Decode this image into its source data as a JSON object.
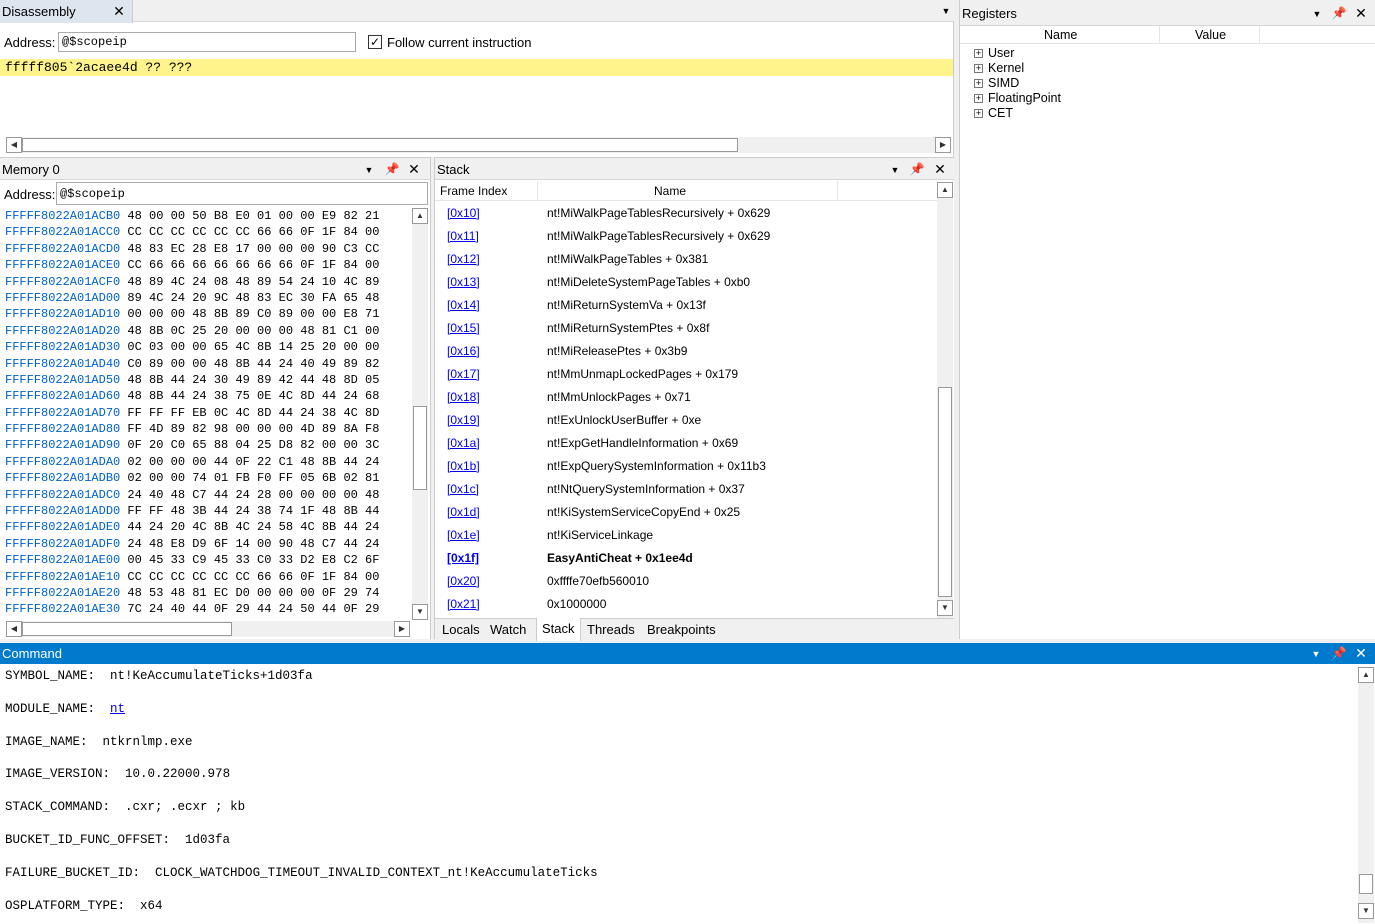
{
  "disassembly": {
    "tab_title": "Disassembly",
    "address_label": "Address:",
    "address_value": "@$scopeip",
    "follow_label": "Follow current instruction",
    "follow_checked": true,
    "current_line": "fffff805`2acaee4d ?? ???"
  },
  "registers": {
    "title": "Registers",
    "col_name": "Name",
    "col_value": "Value",
    "groups": [
      "User",
      "Kernel",
      "SIMD",
      "FloatingPoint",
      "CET"
    ]
  },
  "memory": {
    "title": "Memory 0",
    "address_label": "Address:",
    "address_value": "@$scopeip",
    "rows": [
      {
        "addr": "FFFFF8022A01ACB0",
        "bytes": "48 00 00 50 B8 E0 01 00 00 E9 82 21"
      },
      {
        "addr": "FFFFF8022A01ACC0",
        "bytes": "CC CC CC CC CC CC 66 66 0F 1F 84 00"
      },
      {
        "addr": "FFFFF8022A01ACD0",
        "bytes": "48 83 EC 28 E8 17 00 00 00 90 C3 CC"
      },
      {
        "addr": "FFFFF8022A01ACE0",
        "bytes": "CC 66 66 66 66 66 66 66 0F 1F 84 00"
      },
      {
        "addr": "FFFFF8022A01ACF0",
        "bytes": "48 89 4C 24 08 48 89 54 24 10 4C 89"
      },
      {
        "addr": "FFFFF8022A01AD00",
        "bytes": "89 4C 24 20 9C 48 83 EC 30 FA 65 48"
      },
      {
        "addr": "FFFFF8022A01AD10",
        "bytes": "00 00 00 48 8B 89 C0 89 00 00 E8 71"
      },
      {
        "addr": "FFFFF8022A01AD20",
        "bytes": "48 8B 0C 25 20 00 00 00 48 81 C1 00"
      },
      {
        "addr": "FFFFF8022A01AD30",
        "bytes": "0C 03 00 00 65 4C 8B 14 25 20 00 00"
      },
      {
        "addr": "FFFFF8022A01AD40",
        "bytes": "C0 89 00 00 48 8B 44 24 40 49 89 82"
      },
      {
        "addr": "FFFFF8022A01AD50",
        "bytes": "48 8B 44 24 30 49 89 42 44 48 8D 05"
      },
      {
        "addr": "FFFFF8022A01AD60",
        "bytes": "48 8B 44 24 38 75 0E 4C 8D 44 24 68"
      },
      {
        "addr": "FFFFF8022A01AD70",
        "bytes": "FF FF FF EB 0C 4C 8D 44 24 38 4C 8D"
      },
      {
        "addr": "FFFFF8022A01AD80",
        "bytes": "FF 4D 89 82 98 00 00 00 4D 89 8A F8"
      },
      {
        "addr": "FFFFF8022A01AD90",
        "bytes": "0F 20 C0 65 88 04 25 D8 82 00 00 3C"
      },
      {
        "addr": "FFFFF8022A01ADA0",
        "bytes": "02 00 00 00 44 0F 22 C1 48 8B 44 24"
      },
      {
        "addr": "FFFFF8022A01ADB0",
        "bytes": "02 00 00 74 01 FB F0 FF 05 6B 02 81"
      },
      {
        "addr": "FFFFF8022A01ADC0",
        "bytes": "24 40 48 C7 44 24 28 00 00 00 00 48"
      },
      {
        "addr": "FFFFF8022A01ADD0",
        "bytes": "FF FF 48 3B 44 24 38 74 1F 48 8B 44"
      },
      {
        "addr": "FFFFF8022A01ADE0",
        "bytes": "44 24 20 4C 8B 4C 24 58 4C 8B 44 24"
      },
      {
        "addr": "FFFFF8022A01ADF0",
        "bytes": "24 48 E8 D9 6F 14 00 90 48 C7 44 24"
      },
      {
        "addr": "FFFFF8022A01AE00",
        "bytes": "00 45 33 C9 45 33 C0 33 D2 E8 C2 6F"
      },
      {
        "addr": "FFFFF8022A01AE10",
        "bytes": "CC CC CC CC CC CC 66 66 0F 1F 84 00"
      },
      {
        "addr": "FFFFF8022A01AE20",
        "bytes": "48 53 48 81 EC D0 00 00 00 0F 29 74"
      },
      {
        "addr": "FFFFF8022A01AE30",
        "bytes": "7C 24 40 44 0F 29 44 24 50 44 0F 29"
      }
    ]
  },
  "stack": {
    "title": "Stack",
    "col_frame": "Frame Index",
    "col_name": "Name",
    "frames": [
      {
        "idx": "[0x10]",
        "name": "nt!MiWalkPageTablesRecursively + 0x629",
        "bold": false
      },
      {
        "idx": "[0x11]",
        "name": "nt!MiWalkPageTablesRecursively + 0x629",
        "bold": false
      },
      {
        "idx": "[0x12]",
        "name": "nt!MiWalkPageTables + 0x381",
        "bold": false
      },
      {
        "idx": "[0x13]",
        "name": "nt!MiDeleteSystemPageTables + 0xb0",
        "bold": false
      },
      {
        "idx": "[0x14]",
        "name": "nt!MiReturnSystemVa + 0x13f",
        "bold": false
      },
      {
        "idx": "[0x15]",
        "name": "nt!MiReturnSystemPtes + 0x8f",
        "bold": false
      },
      {
        "idx": "[0x16]",
        "name": "nt!MiReleasePtes + 0x3b9",
        "bold": false
      },
      {
        "idx": "[0x17]",
        "name": "nt!MmUnmapLockedPages + 0x179",
        "bold": false
      },
      {
        "idx": "[0x18]",
        "name": "nt!MmUnlockPages + 0x71",
        "bold": false
      },
      {
        "idx": "[0x19]",
        "name": "nt!ExUnlockUserBuffer + 0xe",
        "bold": false
      },
      {
        "idx": "[0x1a]",
        "name": "nt!ExpGetHandleInformation + 0x69",
        "bold": false
      },
      {
        "idx": "[0x1b]",
        "name": "nt!ExpQuerySystemInformation + 0x11b3",
        "bold": false
      },
      {
        "idx": "[0x1c]",
        "name": "nt!NtQuerySystemInformation + 0x37",
        "bold": false
      },
      {
        "idx": "[0x1d]",
        "name": "nt!KiSystemServiceCopyEnd + 0x25",
        "bold": false
      },
      {
        "idx": "[0x1e]",
        "name": "nt!KiServiceLinkage",
        "bold": false
      },
      {
        "idx": "[0x1f]",
        "name": "EasyAntiCheat + 0x1ee4d",
        "bold": true
      },
      {
        "idx": "[0x20]",
        "name": "0xffffe70efb560010",
        "bold": false
      },
      {
        "idx": "[0x21]",
        "name": "0x1000000",
        "bold": false
      }
    ],
    "tabs": [
      "Locals",
      "Watch",
      "Stack",
      "Threads",
      "Breakpoints"
    ],
    "active_tab": "Stack"
  },
  "command": {
    "title": "Command",
    "lines": [
      {
        "key": "SYMBOL_NAME:",
        "value": "nt!KeAccumulateTicks+1d03fa",
        "link": false
      },
      {
        "key": "MODULE_NAME:",
        "value": "nt",
        "link": true
      },
      {
        "key": "IMAGE_NAME:",
        "value": "ntkrnlmp.exe",
        "link": false
      },
      {
        "key": "IMAGE_VERSION:",
        "value": "10.0.22000.978",
        "link": false
      },
      {
        "key": "STACK_COMMAND:",
        "value": ".cxr; .ecxr ; kb",
        "link": false
      },
      {
        "key": "BUCKET_ID_FUNC_OFFSET:",
        "value": "1d03fa",
        "link": false
      },
      {
        "key": "FAILURE_BUCKET_ID:",
        "value": "CLOCK_WATCHDOG_TIMEOUT_INVALID_CONTEXT_nt!KeAccumulateTicks",
        "link": false
      },
      {
        "key": "OSPLATFORM_TYPE:",
        "value": "x64",
        "link": false
      }
    ]
  },
  "icons": {
    "close": "close-icon",
    "pin": "pin-icon",
    "dropdown": "chevron-down-icon",
    "expand": "plus-box-icon"
  },
  "colors": {
    "accent": "#007acc",
    "highlight": "#fff48c",
    "link": "#0000ee",
    "memory_address": "#0061c9"
  }
}
